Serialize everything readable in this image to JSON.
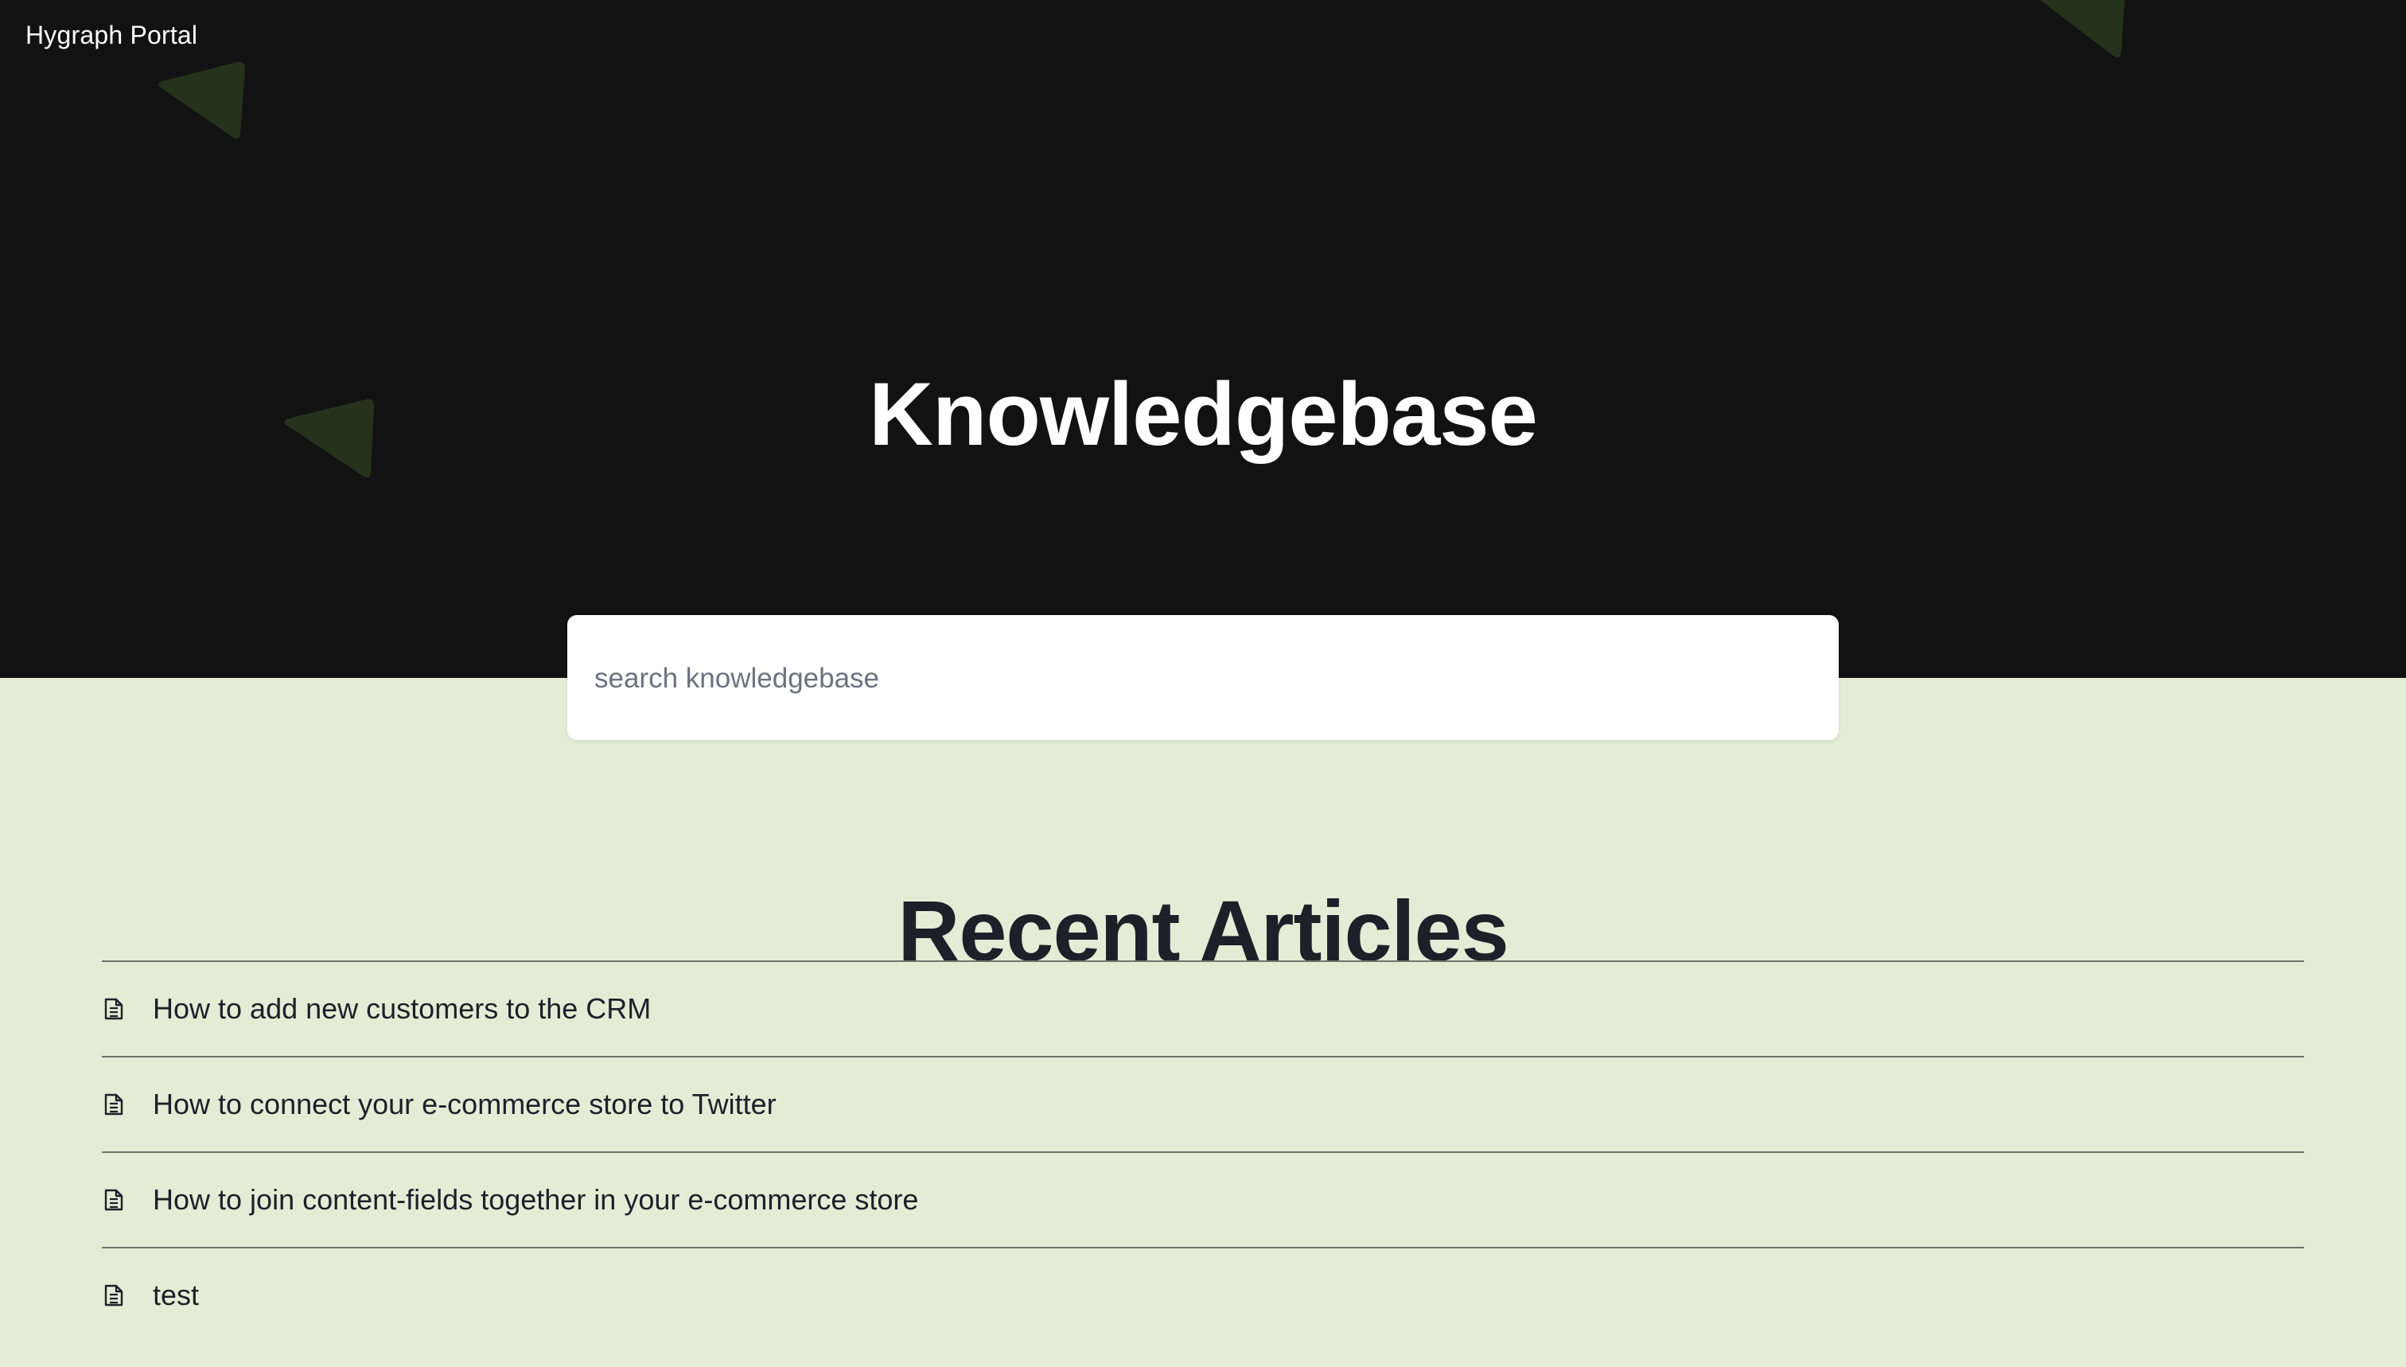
{
  "header": {
    "brand": "Hygraph Portal"
  },
  "hero": {
    "title": "Knowledgebase"
  },
  "search": {
    "placeholder": "search knowledgebase",
    "value": ""
  },
  "recent": {
    "heading": "Recent Articles",
    "articles": [
      {
        "title": "How to add new customers to the CRM",
        "icon": "document-icon"
      },
      {
        "title": "How to connect your e-commerce store to Twitter",
        "icon": "document-icon"
      },
      {
        "title": "How to join content-fields together in your e-commerce store",
        "icon": "document-icon"
      },
      {
        "title": "test",
        "icon": "document-icon"
      }
    ]
  },
  "colors": {
    "hero_background": "#121212",
    "page_background": "#e3edd6",
    "decoration_triangle": "#26331c",
    "text_dark": "#1b2129",
    "divider": "#6f746b"
  }
}
